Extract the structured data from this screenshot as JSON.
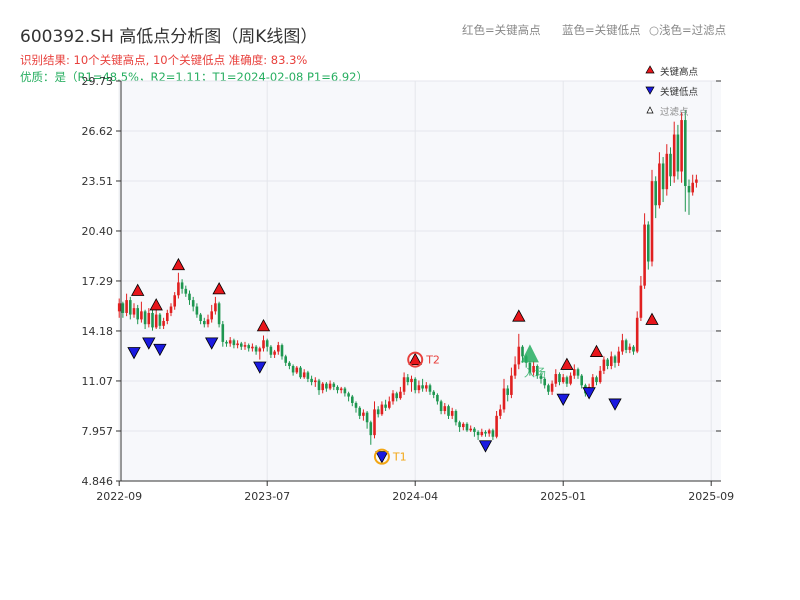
{
  "header": {
    "title": "600392.SH 高低点分析图（周K线图）",
    "result_line": "识别结果: 10个关键高点, 10个关键低点   准确度: 83.3%",
    "quality_line": "优质：是（R1=48.5%，R2=1.11；T1=2024-02-08 P1=6.92）"
  },
  "top_legend": {
    "red": "红色=关键高点",
    "blue": "蓝色=关键低点",
    "light": "○浅色=过滤点"
  },
  "legend": {
    "high": "关键高点",
    "low": "关键低点",
    "filtered": "过滤点"
  },
  "colors": {
    "up": "#e02020",
    "down": "#1e9650",
    "high_marker": "#e8161b",
    "low_marker": "#1a1ae0",
    "t_marker": "#f2a614",
    "entry": "#27ae60",
    "plot_bg": "#f7f8fb"
  },
  "chart_data": {
    "type": "candlestick",
    "title": "600392.SH 高低点分析图（周K线图）",
    "y_ticks": [
      "4.846",
      "7.957",
      "11.07",
      "14.18",
      "17.29",
      "20.40",
      "23.51",
      "26.62",
      "29.73"
    ],
    "ylim": [
      4.846,
      29.73
    ],
    "x_ticks": [
      "2022-09",
      "2023-07",
      "2024-04",
      "2025-01",
      "2025-09"
    ],
    "x_tick_weeks": [
      0,
      40,
      80,
      120,
      160
    ],
    "grid": true,
    "legend_position": "top-right",
    "candles": [
      [
        15.4,
        15.9,
        16.2,
        15.0
      ],
      [
        15.9,
        15.3,
        16.0,
        15.0
      ],
      [
        15.3,
        16.1,
        16.5,
        15.1
      ],
      [
        16.1,
        15.2,
        16.3,
        14.9
      ],
      [
        15.2,
        15.6,
        15.9,
        15.0
      ],
      [
        15.6,
        14.9,
        15.8,
        14.6
      ],
      [
        14.9,
        15.4,
        16.0,
        14.7
      ],
      [
        15.4,
        14.6,
        15.5,
        14.3
      ],
      [
        14.6,
        15.3,
        15.6,
        14.4
      ],
      [
        15.3,
        14.4,
        15.5,
        14.2
      ],
      [
        14.4,
        15.2,
        15.7,
        14.3
      ],
      [
        15.2,
        14.5,
        15.3,
        14.3
      ],
      [
        14.5,
        14.8,
        15.0,
        14.3
      ],
      [
        14.8,
        15.3,
        15.5,
        14.6
      ],
      [
        15.3,
        15.7,
        15.9,
        15.1
      ],
      [
        15.7,
        16.4,
        16.6,
        15.5
      ],
      [
        16.4,
        17.2,
        17.8,
        16.2
      ],
      [
        17.2,
        16.8,
        17.4,
        16.5
      ],
      [
        16.8,
        16.5,
        17.0,
        16.3
      ],
      [
        16.5,
        16.1,
        16.7,
        15.8
      ],
      [
        16.1,
        15.7,
        16.3,
        15.4
      ],
      [
        15.7,
        15.2,
        15.9,
        15.0
      ],
      [
        15.2,
        14.8,
        15.3,
        14.6
      ],
      [
        14.8,
        14.6,
        15.0,
        14.4
      ],
      [
        14.6,
        14.9,
        15.2,
        14.4
      ],
      [
        14.9,
        15.4,
        15.8,
        14.7
      ],
      [
        15.4,
        15.9,
        16.3,
        15.2
      ],
      [
        15.9,
        14.6,
        16.0,
        14.4
      ],
      [
        14.6,
        13.5,
        14.8,
        13.2
      ],
      [
        13.5,
        13.4,
        13.6,
        13.2
      ],
      [
        13.4,
        13.6,
        13.8,
        13.2
      ],
      [
        13.6,
        13.3,
        13.7,
        13.1
      ],
      [
        13.3,
        13.4,
        13.6,
        13.1
      ],
      [
        13.4,
        13.2,
        13.5,
        13.0
      ],
      [
        13.2,
        13.3,
        13.5,
        13.0
      ],
      [
        13.3,
        13.1,
        13.4,
        12.9
      ],
      [
        13.1,
        13.2,
        13.4,
        12.9
      ],
      [
        13.2,
        12.9,
        13.3,
        12.7
      ],
      [
        12.9,
        13.1,
        13.2,
        12.4
      ],
      [
        13.1,
        13.6,
        13.9,
        12.9
      ],
      [
        13.6,
        13.2,
        13.7,
        12.9
      ],
      [
        13.2,
        12.7,
        13.3,
        12.5
      ],
      [
        12.7,
        12.9,
        13.0,
        12.5
      ],
      [
        12.9,
        13.3,
        13.5,
        12.7
      ],
      [
        13.3,
        12.6,
        13.4,
        12.4
      ],
      [
        12.6,
        12.2,
        12.7,
        12.0
      ],
      [
        12.2,
        12.0,
        12.3,
        11.8
      ],
      [
        12.0,
        11.6,
        12.1,
        11.4
      ],
      [
        11.6,
        11.9,
        12.0,
        11.5
      ],
      [
        11.9,
        11.3,
        12.0,
        11.2
      ],
      [
        11.3,
        11.6,
        11.8,
        11.2
      ],
      [
        11.6,
        11.2,
        11.7,
        11.0
      ],
      [
        11.2,
        11.0,
        11.4,
        10.8
      ],
      [
        11.0,
        11.1,
        11.3,
        10.7
      ],
      [
        11.1,
        10.5,
        11.2,
        10.2
      ],
      [
        10.5,
        10.9,
        11.0,
        10.3
      ],
      [
        10.9,
        10.6,
        11.0,
        10.4
      ],
      [
        10.6,
        10.9,
        11.1,
        10.5
      ],
      [
        10.9,
        10.7,
        11.0,
        10.5
      ],
      [
        10.7,
        10.5,
        10.8,
        10.3
      ],
      [
        10.5,
        10.6,
        10.7,
        10.3
      ],
      [
        10.6,
        10.3,
        10.7,
        10.1
      ],
      [
        10.3,
        10.1,
        10.4,
        9.8
      ],
      [
        10.1,
        9.7,
        10.2,
        9.5
      ],
      [
        9.7,
        9.4,
        9.8,
        9.1
      ],
      [
        9.4,
        8.9,
        9.5,
        8.7
      ],
      [
        8.9,
        9.1,
        9.3,
        8.6
      ],
      [
        9.1,
        8.5,
        9.2,
        8.1
      ],
      [
        8.5,
        7.7,
        8.6,
        7.1
      ],
      [
        7.7,
        9.3,
        9.8,
        7.5
      ],
      [
        9.3,
        9.0,
        9.5,
        8.8
      ],
      [
        9.0,
        9.6,
        9.8,
        8.9
      ],
      [
        9.6,
        9.4,
        9.9,
        9.2
      ],
      [
        9.4,
        9.8,
        10.1,
        9.3
      ],
      [
        9.8,
        10.3,
        10.5,
        9.6
      ],
      [
        10.3,
        10.0,
        10.4,
        9.8
      ],
      [
        10.0,
        10.4,
        10.7,
        9.9
      ],
      [
        10.4,
        11.3,
        11.6,
        10.2
      ],
      [
        11.3,
        11.0,
        11.5,
        10.8
      ],
      [
        11.0,
        11.2,
        11.4,
        10.4
      ],
      [
        11.2,
        10.5,
        11.3,
        10.3
      ],
      [
        10.5,
        10.8,
        11.1,
        10.3
      ],
      [
        10.8,
        10.6,
        11.2,
        10.4
      ],
      [
        10.6,
        10.8,
        11.0,
        10.4
      ],
      [
        10.8,
        10.4,
        10.9,
        10.2
      ],
      [
        10.4,
        10.2,
        10.5,
        10.0
      ],
      [
        10.2,
        9.8,
        10.3,
        9.6
      ],
      [
        9.8,
        9.2,
        9.9,
        9.0
      ],
      [
        9.2,
        9.5,
        9.7,
        9.0
      ],
      [
        9.5,
        8.9,
        9.6,
        8.7
      ],
      [
        8.9,
        9.2,
        9.4,
        8.7
      ],
      [
        9.2,
        8.5,
        9.3,
        8.3
      ],
      [
        8.5,
        8.2,
        8.6,
        7.9
      ],
      [
        8.2,
        8.4,
        8.5,
        8.0
      ],
      [
        8.4,
        8.0,
        8.5,
        7.9
      ],
      [
        8.0,
        8.1,
        8.3,
        7.9
      ],
      [
        8.1,
        7.9,
        8.2,
        7.6
      ],
      [
        7.9,
        7.7,
        8.0,
        7.4
      ],
      [
        7.7,
        7.9,
        8.1,
        7.6
      ],
      [
        7.9,
        7.8,
        8.0,
        7.6
      ],
      [
        7.8,
        8.0,
        8.1,
        7.6
      ],
      [
        8.0,
        7.6,
        8.1,
        7.4
      ],
      [
        7.6,
        8.9,
        9.2,
        7.5
      ],
      [
        8.9,
        9.3,
        9.6,
        8.7
      ],
      [
        9.3,
        10.6,
        11.2,
        9.1
      ],
      [
        10.6,
        10.2,
        10.8,
        9.8
      ],
      [
        10.2,
        11.4,
        11.9,
        10.0
      ],
      [
        11.4,
        12.1,
        12.6,
        11.2
      ],
      [
        12.1,
        13.2,
        14.0,
        11.8
      ],
      [
        13.2,
        12.6,
        13.3,
        12.2
      ],
      [
        12.6,
        12.2,
        12.7,
        11.9
      ],
      [
        12.2,
        11.6,
        12.3,
        11.4
      ],
      [
        11.6,
        12.0,
        12.3,
        11.4
      ],
      [
        12.0,
        11.4,
        12.1,
        11.2
      ],
      [
        11.4,
        11.2,
        11.6,
        10.9
      ],
      [
        11.2,
        10.8,
        11.3,
        10.6
      ],
      [
        10.8,
        10.4,
        10.9,
        10.2
      ],
      [
        10.4,
        10.9,
        11.1,
        10.2
      ],
      [
        10.9,
        11.5,
        11.8,
        10.7
      ],
      [
        11.5,
        11.0,
        11.6,
        10.8
      ],
      [
        11.0,
        11.3,
        11.5,
        10.9
      ],
      [
        11.3,
        10.9,
        11.4,
        10.7
      ],
      [
        10.9,
        11.4,
        11.6,
        10.8
      ],
      [
        11.4,
        11.8,
        12.1,
        11.2
      ],
      [
        11.8,
        11.4,
        11.9,
        11.2
      ],
      [
        11.4,
        10.8,
        11.5,
        10.6
      ],
      [
        10.8,
        10.3,
        10.9,
        10.1
      ],
      [
        10.3,
        10.7,
        10.9,
        10.2
      ],
      [
        10.7,
        11.3,
        11.5,
        10.5
      ],
      [
        11.3,
        11.0,
        11.4,
        10.8
      ],
      [
        11.0,
        11.7,
        12.0,
        10.9
      ],
      [
        11.7,
        12.4,
        12.6,
        11.5
      ],
      [
        12.4,
        12.0,
        12.5,
        11.8
      ],
      [
        12.0,
        12.6,
        12.9,
        11.8
      ],
      [
        12.6,
        12.2,
        12.7,
        11.9
      ],
      [
        12.2,
        12.9,
        13.2,
        12.0
      ],
      [
        12.9,
        13.6,
        14.0,
        12.7
      ],
      [
        13.6,
        13.0,
        13.7,
        12.8
      ],
      [
        13.0,
        13.2,
        13.4,
        12.8
      ],
      [
        13.2,
        12.9,
        13.3,
        12.7
      ],
      [
        12.9,
        15.0,
        15.4,
        12.8
      ],
      [
        15.0,
        17.0,
        17.6,
        14.8
      ],
      [
        17.0,
        20.8,
        21.5,
        16.8
      ],
      [
        20.8,
        18.5,
        21.0,
        18.0
      ],
      [
        18.5,
        23.5,
        24.2,
        18.2
      ],
      [
        23.5,
        22.0,
        23.8,
        21.2
      ],
      [
        22.0,
        24.6,
        25.3,
        21.8
      ],
      [
        24.6,
        23.0,
        25.0,
        22.2
      ],
      [
        23.0,
        25.2,
        25.8,
        22.6
      ],
      [
        25.2,
        23.8,
        25.6,
        23.2
      ],
      [
        23.8,
        26.4,
        27.2,
        23.4
      ],
      [
        26.4,
        24.1,
        27.0,
        23.6
      ],
      [
        24.1,
        27.3,
        27.8,
        23.4
      ],
      [
        27.3,
        23.2,
        27.9,
        21.6
      ],
      [
        23.2,
        22.8,
        23.6,
        21.4
      ],
      [
        22.8,
        23.4,
        23.9,
        22.6
      ],
      [
        23.4,
        23.6,
        23.9,
        23.1
      ]
    ],
    "key_highs": [
      {
        "week": 5,
        "value": 16.2
      },
      {
        "week": 10,
        "value": 15.3
      },
      {
        "week": 16,
        "value": 17.8
      },
      {
        "week": 27,
        "value": 16.3
      },
      {
        "week": 39,
        "value": 14.0
      },
      {
        "week": 108,
        "value": 14.6
      },
      {
        "week": 121,
        "value": 11.6
      },
      {
        "week": 129,
        "value": 12.4
      },
      {
        "week": 144,
        "value": 14.4
      },
      {
        "week": 80,
        "value": 11.9
      }
    ],
    "key_lows": [
      {
        "week": 4,
        "value": 13.4
      },
      {
        "week": 8,
        "value": 14.0
      },
      {
        "week": 11,
        "value": 13.6
      },
      {
        "week": 25,
        "value": 14.0
      },
      {
        "week": 38,
        "value": 12.5
      },
      {
        "week": 71,
        "value": 6.92
      },
      {
        "week": 99,
        "value": 7.6
      },
      {
        "week": 120,
        "value": 10.5
      },
      {
        "week": 127,
        "value": 10.9
      },
      {
        "week": 134,
        "value": 10.2
      }
    ],
    "t1": {
      "label": "T1",
      "week": 71,
      "value": 6.92
    },
    "t2": {
      "label": "T2",
      "week": 80,
      "value": 11.9
    },
    "entry": {
      "label": "入场",
      "week": 111,
      "value": 12.6
    }
  }
}
